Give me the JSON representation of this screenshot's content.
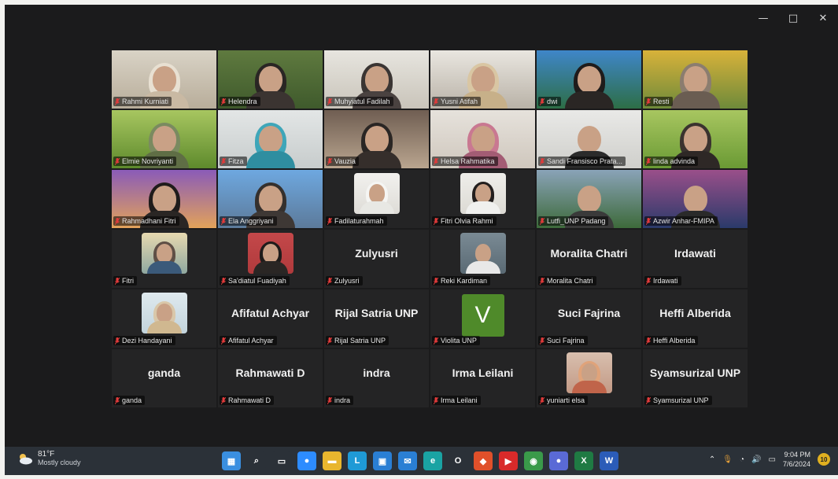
{
  "window_controls": {
    "minimize": "—",
    "maximize": "□",
    "close": "✕"
  },
  "participants": [
    {
      "name": "Rahmi Kurniati",
      "type": "video",
      "bg": [
        "#d9d3c6",
        "#b8ad9a"
      ],
      "hijab": "#e8e0d2",
      "body": "#c9b9a3"
    },
    {
      "name": "Helendra",
      "type": "video",
      "bg": [
        "#5f7a3f",
        "#3f5a2c"
      ],
      "hijab": "#2a2624",
      "body": "#3b3431"
    },
    {
      "name": "Muhyiatul Fadilah",
      "type": "video",
      "bg": [
        "#e7e5df",
        "#c9c4ba"
      ],
      "hijab": "#3a3533",
      "body": "#4a4240"
    },
    {
      "name": "Yusni Atifah",
      "type": "video",
      "bg": [
        "#e9e6e0",
        "#b9b2a7"
      ],
      "hijab": "#d9c6a3",
      "body": "#c7b089"
    },
    {
      "name": "dwi",
      "type": "video",
      "active": true,
      "bg": [
        "#3f86c9",
        "#2d6e46"
      ],
      "hijab": "#1f1c1b",
      "body": "#2a2624"
    },
    {
      "name": "Resti",
      "type": "video",
      "bg": [
        "#d8b23a",
        "#6e8a3a"
      ],
      "hijab": "#8b7d6f",
      "body": "#6a5d52"
    },
    {
      "name": "Elmie Novriyanti",
      "type": "video",
      "bg": [
        "#a8c660",
        "#5e8a2c"
      ],
      "hijab": "#7a8a60",
      "body": "#5f6e45"
    },
    {
      "name": "Fitza",
      "type": "video",
      "bg": [
        "#e3e6e6",
        "#c7cccc"
      ],
      "hijab": "#3ea6b9",
      "body": "#2f8ea0"
    },
    {
      "name": "Vauzia",
      "type": "video",
      "bg": [
        "#6f5e52",
        "#b9a58f"
      ],
      "hijab": "#2a2624",
      "body": "#352e2b"
    },
    {
      "name": "Helsa Rahmatika",
      "type": "video",
      "bg": [
        "#e6e2dc",
        "#cfc7bd"
      ],
      "hijab": "#c97891",
      "body": "#a35c74"
    },
    {
      "name": "Sandi Fransisco Prata...",
      "type": "video",
      "bg": [
        "#e9e9e7",
        "#cfcfcb"
      ],
      "hijab": "",
      "body": "#2b2b2b"
    },
    {
      "name": "linda advinda",
      "type": "video",
      "bg": [
        "#a8c660",
        "#6a9a34"
      ],
      "hijab": "#3a332f",
      "body": "#2e2826"
    },
    {
      "name": "Rahmadhani Fitri",
      "type": "video",
      "bg": [
        "#8a5bb8",
        "#e2a25a"
      ],
      "hijab": "#1f1c1b",
      "body": "#2a2624"
    },
    {
      "name": "Ela Anggriyani",
      "type": "video",
      "bg": [
        "#6ea8e0",
        "#5c7a9a"
      ],
      "hijab": "#35302d",
      "body": "#3e3835"
    },
    {
      "name": "Fadilaturahmah",
      "type": "thumb",
      "bg": [
        "#f2f1ee",
        "#dedcd7"
      ],
      "hijab": "#f5f5f3",
      "body": "#e8e8e4"
    },
    {
      "name": "Fitri Olvia Rahmi",
      "type": "thumb",
      "bg": [
        "#efeeea",
        "#dcdad4"
      ],
      "hijab": "#231f1e",
      "body": "#f0f0ee"
    },
    {
      "name": "Lutfi_UNP Padang",
      "type": "video",
      "bg": [
        "#8aa3b8",
        "#3d6a3a"
      ],
      "hijab": "",
      "body": "#3a3a3a"
    },
    {
      "name": "Azwir Anhar-FMIPA",
      "type": "video",
      "bg": [
        "#9a4f8a",
        "#2a3a6a"
      ],
      "hijab": "",
      "body": "#2a2a2a"
    },
    {
      "name": "Fitri",
      "type": "thumb",
      "bg": [
        "#e7d9b0",
        "#8fa8a0"
      ],
      "hijab": "#5f4f46",
      "body": "#3b5a7a"
    },
    {
      "name": "Sa'diatul Fuadiyah",
      "type": "thumb",
      "bg": [
        "#c4484a",
        "#b03a3c"
      ],
      "hijab": "#1f1c1b",
      "body": "#2a2624"
    },
    {
      "name": "Zulyusri",
      "type": "name",
      "display": "Zulyusri"
    },
    {
      "name": "Reki Kardiman",
      "type": "thumb",
      "bg": [
        "#7a8a94",
        "#5a6a74"
      ],
      "hijab": "",
      "body": "#e8e8e8"
    },
    {
      "name": "Moralita Chatri",
      "type": "name",
      "display": "Moralita Chatri"
    },
    {
      "name": "Irdawati",
      "type": "name",
      "display": "Irdawati"
    },
    {
      "name": "Dezi Handayani",
      "type": "thumb",
      "bg": [
        "#dfe9ee",
        "#c2d4dc"
      ],
      "hijab": "#d9c7a9",
      "body": "#d0b890"
    },
    {
      "name": "Afifatul Achyar",
      "type": "name",
      "display": "Afifatul Achyar"
    },
    {
      "name": "Rijal Satria UNP",
      "type": "name",
      "display": "Rijal Satria UNP"
    },
    {
      "name": "Violita UNP",
      "type": "letter",
      "display": "V"
    },
    {
      "name": "Suci Fajrina",
      "type": "name",
      "display": "Suci Fajrina"
    },
    {
      "name": "Heffi Alberida",
      "type": "name",
      "display": "Heffi Alberida"
    },
    {
      "name": "ganda",
      "type": "name",
      "display": "ganda"
    },
    {
      "name": "Rahmawati D",
      "type": "name",
      "display": "Rahmawati D"
    },
    {
      "name": "indra",
      "type": "name",
      "display": "indra"
    },
    {
      "name": "Irma Leilani",
      "type": "name",
      "display": "Irma Leilani"
    },
    {
      "name": "yuniarti elsa",
      "type": "thumb",
      "bg": [
        "#d8bfae",
        "#c39a86"
      ],
      "hijab": "#e0a37a",
      "body": "#c0644a"
    },
    {
      "name": "Syamsurizal UNP",
      "type": "name",
      "display": "Syamsurizal UNP"
    }
  ],
  "taskbar": {
    "weather_temp": "81°F",
    "weather_desc": "Mostly cloudy",
    "time": "9:04 PM",
    "date": "7/6/2024",
    "notification_count": "10",
    "apps": [
      {
        "icon": "windows-start-icon",
        "color": "#3a8fe0",
        "glyph": "▦"
      },
      {
        "icon": "search-icon",
        "color": "#2b3138",
        "glyph": "⌕"
      },
      {
        "icon": "task-view-icon",
        "color": "#2b3138",
        "glyph": "▭"
      },
      {
        "icon": "zoom-icon",
        "color": "#2d8cff",
        "glyph": "●"
      },
      {
        "icon": "file-explorer-icon",
        "color": "#e8b62e",
        "glyph": "▬"
      },
      {
        "icon": "l-app-icon",
        "color": "#1f9ad6",
        "glyph": "L"
      },
      {
        "icon": "calendar-icon",
        "color": "#2a7fd4",
        "glyph": "▣"
      },
      {
        "icon": "mail-icon",
        "color": "#2a7fd4",
        "glyph": "✉"
      },
      {
        "icon": "edge-icon",
        "color": "#1aa3a3",
        "glyph": "e"
      },
      {
        "icon": "opera-icon",
        "color": "#2b3138",
        "glyph": "O"
      },
      {
        "icon": "brave-icon",
        "color": "#e0502a",
        "glyph": "◆"
      },
      {
        "icon": "youtube-icon",
        "color": "#d92a2a",
        "glyph": "▶"
      },
      {
        "icon": "chrome-icon",
        "color": "#3a9a4a",
        "glyph": "◉"
      },
      {
        "icon": "teams-icon",
        "color": "#5a6ad6",
        "glyph": "●"
      },
      {
        "icon": "excel-icon",
        "color": "#1f7a43",
        "glyph": "X"
      },
      {
        "icon": "word-icon",
        "color": "#2b5cb8",
        "glyph": "W"
      }
    ]
  }
}
